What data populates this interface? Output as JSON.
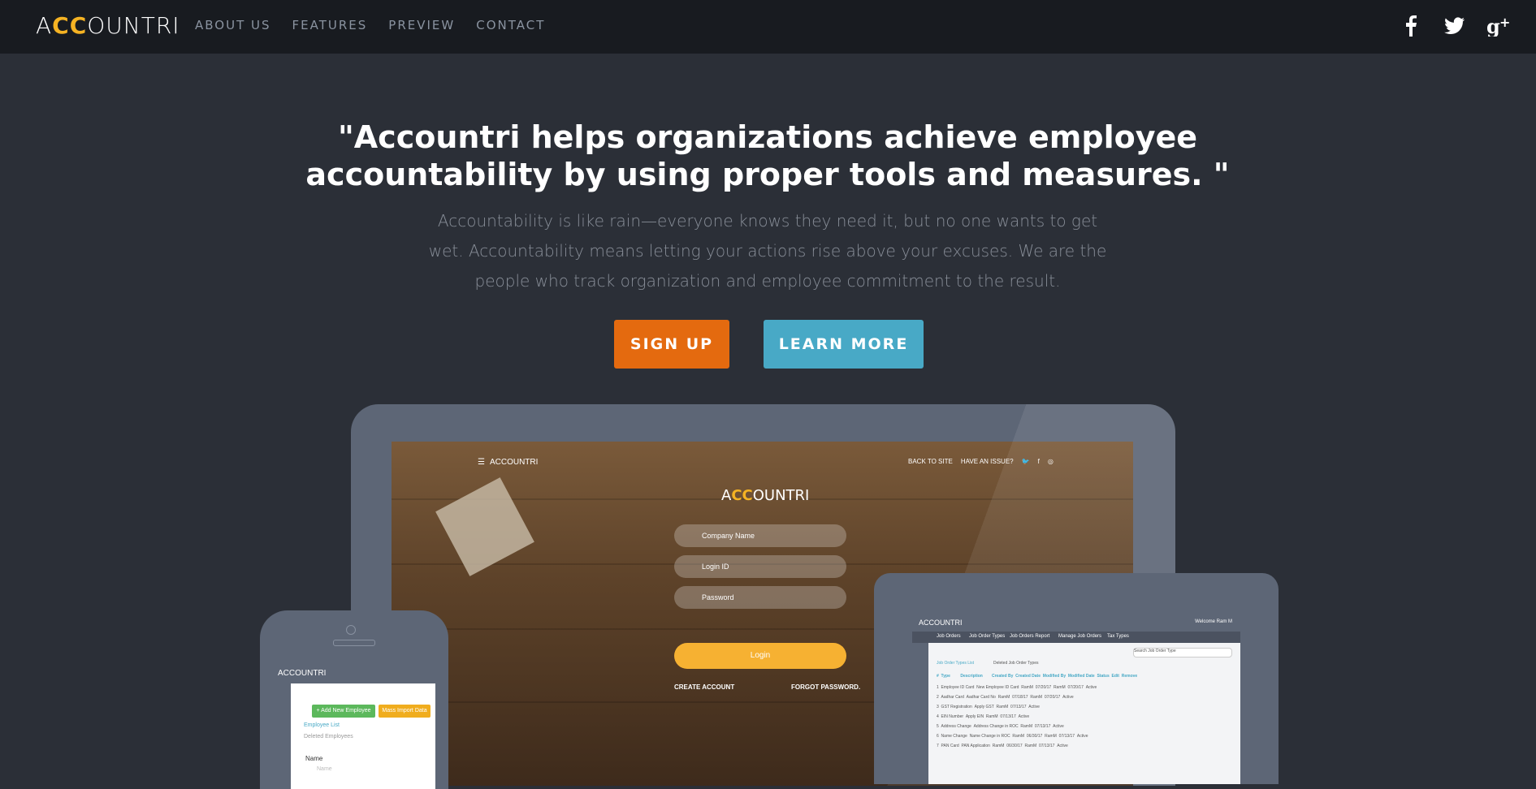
{
  "nav": {
    "brand": "ACCOUNTRI",
    "links": [
      "ABOUT US",
      "FEATURES",
      "PREVIEW",
      "CONTACT"
    ],
    "social_icons": [
      "facebook-icon",
      "twitter-icon",
      "google-plus-icon"
    ]
  },
  "hero": {
    "headline": "\"Accountri helps organizations achieve employee accountability by using proper tools and measures. \"",
    "subtext": "Accountability is like rain—everyone knows they need it, but no one wants to get wet. Accountability means letting your actions rise above your excuses. We are the people who track organization and employee commitment to the result.",
    "signup_label": "SIGN UP",
    "learn_label": "LEARN MORE"
  },
  "laptop": {
    "app_title": "ACCOUNTRI",
    "top_links": [
      "BACK TO SITE",
      "HAVE AN ISSUE?"
    ],
    "brand": "ACCOUNTRI",
    "company_placeholder": "Company Name",
    "login_placeholder": "Login ID",
    "password_placeholder": "Password",
    "login_label": "Login",
    "create_account": "CREATE ACCOUNT",
    "forgot_password": "FORGOT PASSWORD."
  },
  "tablet": {
    "brand": "ACCOUNTRI",
    "welcome": "Welcome Ram M",
    "menu": [
      "Job Orders",
      "Job Order Types",
      "Job Orders Report",
      "Manage Job Orders",
      "Tax Types"
    ],
    "tabs": [
      "Job Order Types List",
      "Deleted Job Order Types"
    ],
    "search_placeholder": "Search Job Order Type",
    "columns": [
      "#",
      "Type",
      "Description",
      "Created By",
      "Created Date",
      "Modified By",
      "Modified Date",
      "Status",
      "Edit",
      "Remove"
    ],
    "rows": [
      [
        "1",
        "Employee ID Card",
        "New Employee ID Card",
        "RamM",
        "07/20/17",
        "RamM",
        "07/20/17",
        "Active"
      ],
      [
        "2",
        "Aadhar Card",
        "Aadhar Card No",
        "RamM",
        "07/18/17",
        "RamM",
        "07/20/17",
        "Active"
      ],
      [
        "3",
        "GST Registration",
        "Apply GST",
        "RamM",
        "07/13/17",
        "",
        "",
        "Active"
      ],
      [
        "4",
        "EIN Number",
        "Apply EIN",
        "RamM",
        "07/13/17",
        "",
        "",
        "Active"
      ],
      [
        "5",
        "Address Change",
        "Address Change in ROC",
        "RamM",
        "07/13/17",
        "",
        "",
        "Active"
      ],
      [
        "6",
        "Name Change",
        "Name Change in ROC",
        "RamM",
        "06/30/17",
        "RamM",
        "07/13/17",
        "Active"
      ],
      [
        "7",
        "PAN Card",
        "PAN Application",
        "RamM",
        "06/30/17",
        "RamM",
        "07/13/17",
        "Active"
      ]
    ]
  },
  "phone": {
    "brand": "ACCOUNTRI",
    "add_button": "+ Add New Employee",
    "import_button": "Mass Import Data",
    "links": [
      "Employee List",
      "Deleted Employees"
    ],
    "field_label": "Name",
    "field_placeholder": "Name"
  }
}
